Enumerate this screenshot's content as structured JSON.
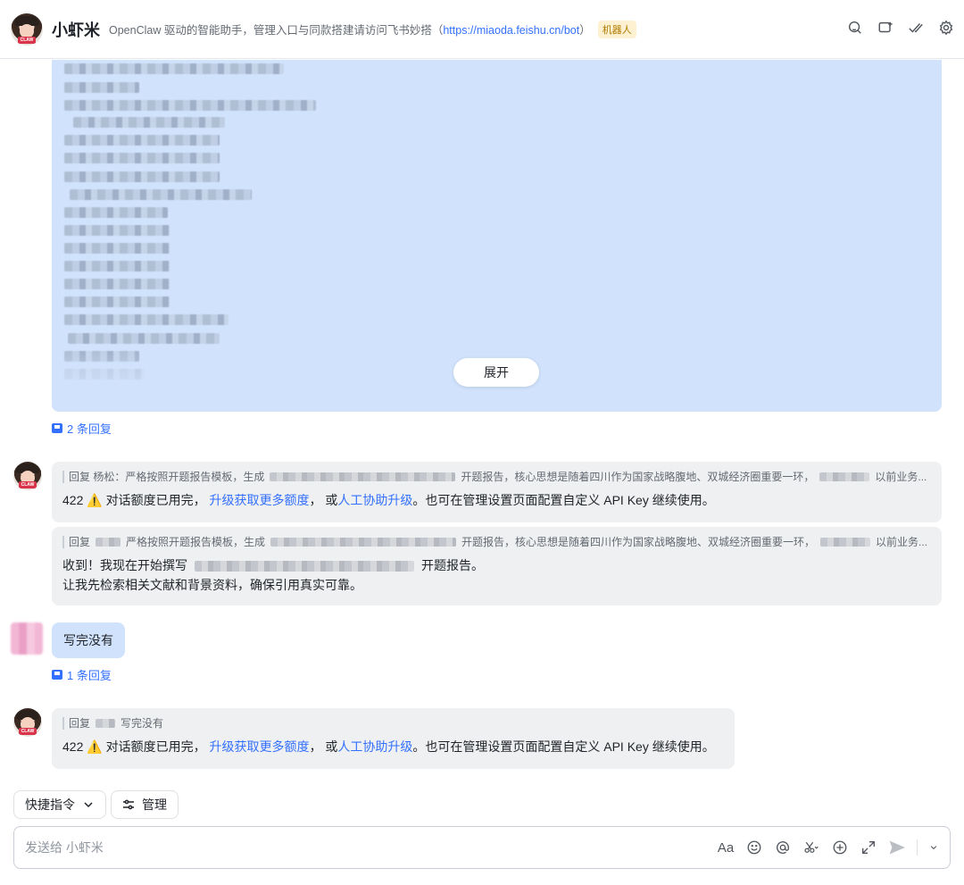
{
  "header": {
    "title": "小虾米",
    "description": "OpenClaw 驱动的智能助手，管理入口与同款搭建请访问飞书妙搭（",
    "description_link": "https://miaoda.feishu.cn/bot",
    "description_end": "）",
    "badge": "机器人",
    "icons": [
      "search-icon",
      "add-chat-icon",
      "check-icon",
      "settings-icon"
    ]
  },
  "first_message": {
    "expand_label": "展开",
    "reply_count": "2 条回复"
  },
  "bot_replies": [
    {
      "quote_prefix": "回复 杨松：",
      "quote_text": "严格按照开题报告模板，生成",
      "quote_mid": "开题报告，核心思想是随着四川作为国家战略腹地、双城经济圈重要一环，",
      "quote_end": "以前业务...",
      "code": "422",
      "warn": "⚠️",
      "text_a": "对话额度已用完，",
      "link1": "升级获取更多额度",
      "text_b": "，  或",
      "link2": "人工协助升级",
      "text_c": "。也可在管理设置页面配置自定义 API Key 继续使用。"
    },
    {
      "quote_prefix": "回复",
      "quote_text": "严格按照开题报告模板，生成",
      "quote_mid": "开题报告，核心思想是随着四川作为国家战略腹地、双城经济圈重要一环，",
      "quote_end": "以前业务...",
      "line1_a": "收到！我现在开始撰写",
      "line1_b": "开题报告。",
      "line2": "让我先检索相关文献和背景资料，确保引用真实可靠。"
    }
  ],
  "user_message": {
    "text": "写完没有",
    "reply_count": "1 条回复"
  },
  "last_reply": {
    "quote_prefix": "回复",
    "quote_text": "写完没有",
    "code": "422",
    "warn": "⚠️",
    "text_a": "对话额度已用完，",
    "link1": "升级获取更多额度",
    "text_b": "，  或",
    "link2": "人工协助升级",
    "text_c": "。也可在管理设置页面配置自定义 API Key 继续使用。"
  },
  "toolbar": {
    "quick_commands": "快捷指令",
    "manage": "管理"
  },
  "input": {
    "placeholder": "发送给 小虾米",
    "tools": [
      "text-format-icon",
      "emoji-icon",
      "mention-icon",
      "scissors-icon",
      "plus-circle-icon",
      "expand-icon",
      "send-icon",
      "chevron-down-icon"
    ],
    "format_glyph": "Aa"
  }
}
